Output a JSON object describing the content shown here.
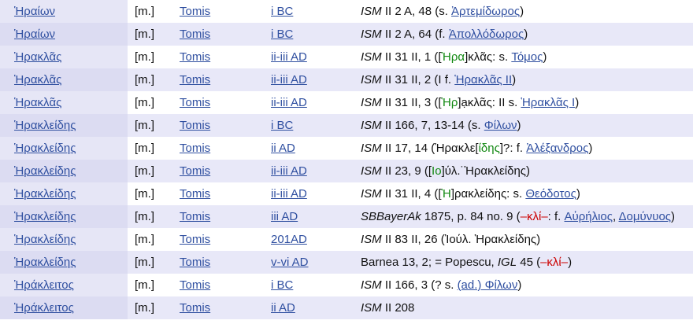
{
  "rows": [
    {
      "name": "Ἡραίων",
      "gender": "[m.]",
      "place": "Tomis",
      "date": "i BC",
      "ref": [
        {
          "t": "ISM",
          "s": "it"
        },
        {
          "t": " II 2 A, 48 (s. "
        },
        {
          "t": "Ἀρτεμίδωρος",
          "s": "link"
        },
        {
          "t": ")"
        }
      ]
    },
    {
      "name": "Ἡραίων",
      "gender": "[m.]",
      "place": "Tomis",
      "date": "i BC",
      "ref": [
        {
          "t": "ISM",
          "s": "it"
        },
        {
          "t": " II 2 A, 64 (f. "
        },
        {
          "t": "Ἀπολλόδωρος",
          "s": "link"
        },
        {
          "t": ")"
        }
      ]
    },
    {
      "name": "Ἡρακλᾶς",
      "gender": "[m.]",
      "place": "Tomis",
      "date": "ii-iii AD",
      "ref": [
        {
          "t": "ISM",
          "s": "it"
        },
        {
          "t": " II 31 II, 1 (["
        },
        {
          "t": "Ἡρα",
          "s": "g"
        },
        {
          "t": "]κλᾶς: s. "
        },
        {
          "t": "Τόμος",
          "s": "link"
        },
        {
          "t": ")"
        }
      ]
    },
    {
      "name": "Ἡρακλᾶς",
      "gender": "[m.]",
      "place": "Tomis",
      "date": "ii-iii AD",
      "ref": [
        {
          "t": "ISM",
          "s": "it"
        },
        {
          "t": " II 31 II, 2 (I f. "
        },
        {
          "t": "Ἡρακλᾶς II",
          "s": "link"
        },
        {
          "t": ")"
        }
      ]
    },
    {
      "name": "Ἡρακλᾶς",
      "gender": "[m.]",
      "place": "Tomis",
      "date": "ii-iii AD",
      "ref": [
        {
          "t": "ISM",
          "s": "it"
        },
        {
          "t": " II 31 II, 3 (["
        },
        {
          "t": "Ἡρ",
          "s": "g"
        },
        {
          "t": "]ạκλᾶς: II s. "
        },
        {
          "t": "Ἡρακλᾶς I",
          "s": "link"
        },
        {
          "t": ")"
        }
      ]
    },
    {
      "name": "Ἡρακλείδης",
      "gender": "[m.]",
      "place": "Tomis",
      "date": "i BC",
      "ref": [
        {
          "t": "ISM",
          "s": "it"
        },
        {
          "t": " II 166, 7, 13-14 (s. "
        },
        {
          "t": "Φίλων",
          "s": "link"
        },
        {
          "t": ")"
        }
      ]
    },
    {
      "name": "Ἡρακλείδης",
      "gender": "[m.]",
      "place": "Tomis",
      "date": "ii AD",
      "ref": [
        {
          "t": "ISM",
          "s": "it"
        },
        {
          "t": " II 17, 14 (Ἡρακλε["
        },
        {
          "t": "ίδης",
          "s": "g"
        },
        {
          "t": "]?: f. "
        },
        {
          "t": "Ἀλέξανδρος",
          "s": "link"
        },
        {
          "t": ")"
        }
      ]
    },
    {
      "name": "Ἡρακλείδης",
      "gender": "[m.]",
      "place": "Tomis",
      "date": "ii-iii AD",
      "ref": [
        {
          "t": "ISM",
          "s": "it"
        },
        {
          "t": " II 23, 9 (["
        },
        {
          "t": "Ιο",
          "s": "g"
        },
        {
          "t": "]ύλ.˙Ἡρακλείδης)"
        }
      ]
    },
    {
      "name": "Ἡρακλείδης",
      "gender": "[m.]",
      "place": "Tomis",
      "date": "ii-iii AD",
      "ref": [
        {
          "t": "ISM",
          "s": "it"
        },
        {
          "t": " II 31 II, 4 (["
        },
        {
          "t": "Ἡ",
          "s": "g"
        },
        {
          "t": "]ρακλείδης: s. "
        },
        {
          "t": "Θεόδοτος",
          "s": "link"
        },
        {
          "t": ")"
        }
      ]
    },
    {
      "name": "Ἡρακλείδης",
      "gender": "[m.]",
      "place": "Tomis",
      "date": "iii AD",
      "ref": [
        {
          "t": "SBBayerAk",
          "s": "it"
        },
        {
          "t": " 1875, p. 84 no. 9 ("
        },
        {
          "t": "–κλί–",
          "s": "r"
        },
        {
          "t": ": f. "
        },
        {
          "t": "Αὐρήλιος",
          "s": "link"
        },
        {
          "t": ", "
        },
        {
          "t": "Δομύνυος",
          "s": "link"
        },
        {
          "t": ")"
        }
      ]
    },
    {
      "name": "Ἡρακλείδης",
      "gender": "[m.]",
      "place": "Tomis",
      "date": "201AD",
      "ref": [
        {
          "t": "ISM",
          "s": "it"
        },
        {
          "t": " II 83 II, 26 (Ἰούλ. Ἡρακλείδης)"
        }
      ]
    },
    {
      "name": "Ἡρακλείδης",
      "gender": "[m.]",
      "place": "Tomis",
      "date": "v-vi AD",
      "ref": [
        {
          "t": "Barnea 13, 2; = Popescu, "
        },
        {
          "t": "IGL",
          "s": "it"
        },
        {
          "t": " 45 ("
        },
        {
          "t": "–κλί–",
          "s": "r"
        },
        {
          "t": ")"
        }
      ]
    },
    {
      "name": "Ἡράκλειτος",
      "gender": "[m.]",
      "place": "Tomis",
      "date": "i BC",
      "ref": [
        {
          "t": "ISM",
          "s": "it"
        },
        {
          "t": " II 166, 3 (? s. "
        },
        {
          "t": "(ad.) Φίλων",
          "s": "link"
        },
        {
          "t": ")"
        }
      ]
    },
    {
      "name": "Ἡράκλειτος",
      "gender": "[m.]",
      "place": "Tomis",
      "date": "ii AD",
      "ref": [
        {
          "t": "ISM",
          "s": "it"
        },
        {
          "t": " II 208"
        }
      ]
    }
  ]
}
